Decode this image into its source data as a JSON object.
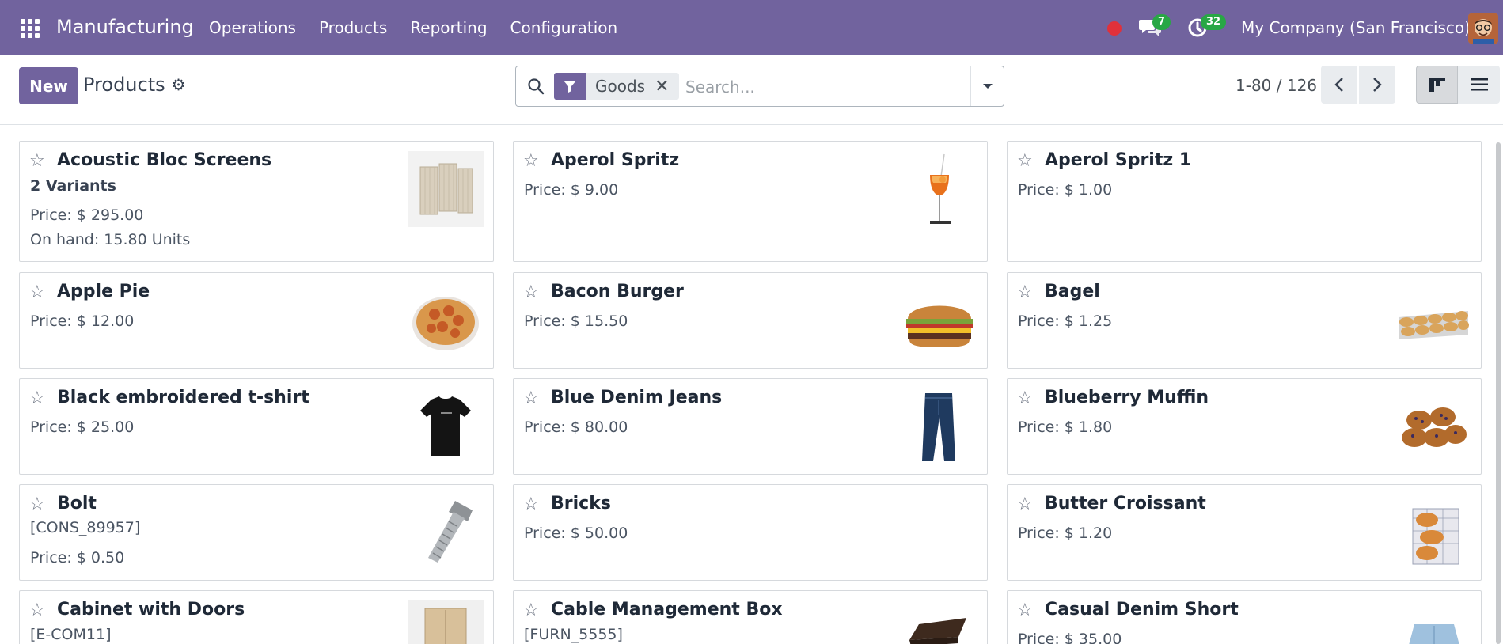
{
  "navbar": {
    "app_name": "Manufacturing",
    "menu": [
      "Operations",
      "Products",
      "Reporting",
      "Configuration"
    ],
    "chat_count": "7",
    "activity_count": "32",
    "company": "My Company (San Francisco)"
  },
  "control": {
    "new_label": "New",
    "breadcrumb": "Products",
    "facet_label": "Goods",
    "search_placeholder": "Search...",
    "pager": "1-80 / 126"
  },
  "products": [
    {
      "name": "Acoustic Bloc Screens",
      "variants": "2 Variants",
      "price": "Price: $ 295.00",
      "onhand": "On hand: 15.80 Units",
      "image": "acoustic-screen-image"
    },
    {
      "name": "Aperol Spritz",
      "price": "Price: $ 9.00",
      "image": "aperol-glass-image"
    },
    {
      "name": "Aperol Spritz 1",
      "price": "Price: $ 1.00"
    },
    {
      "name": "Apple Pie",
      "price": "Price: $ 12.00",
      "image": "apple-pie-image"
    },
    {
      "name": "Bacon Burger",
      "price": "Price: $ 15.50",
      "image": "burger-image"
    },
    {
      "name": "Bagel",
      "price": "Price: $ 1.25",
      "image": "bagel-tray-image"
    },
    {
      "name": "Black embroidered t-shirt",
      "price": "Price: $ 25.00",
      "image": "tshirt-image"
    },
    {
      "name": "Blue Denim Jeans",
      "price": "Price: $ 80.00",
      "image": "jeans-image"
    },
    {
      "name": "Blueberry Muffin",
      "price": "Price: $ 1.80",
      "image": "muffin-image"
    },
    {
      "name": "Bolt",
      "ref": "[CONS_89957]",
      "price": "Price: $ 0.50",
      "image": "bolt-image"
    },
    {
      "name": "Bricks",
      "price": "Price: $ 50.00"
    },
    {
      "name": "Butter Croissant",
      "price": "Price: $ 1.20",
      "image": "croissant-image"
    },
    {
      "name": "Cabinet with Doors",
      "ref": "[E-COM11]",
      "image": "cabinet-image"
    },
    {
      "name": "Cable Management Box",
      "ref": "[FURN_5555]",
      "image": "cable-box-image"
    },
    {
      "name": "Casual Denim Short",
      "price": "Price: $ 35.00",
      "image": "denim-short-image"
    }
  ],
  "colors": {
    "brand": "#71639e",
    "badge": "#28a745",
    "record": "#e0313b"
  }
}
